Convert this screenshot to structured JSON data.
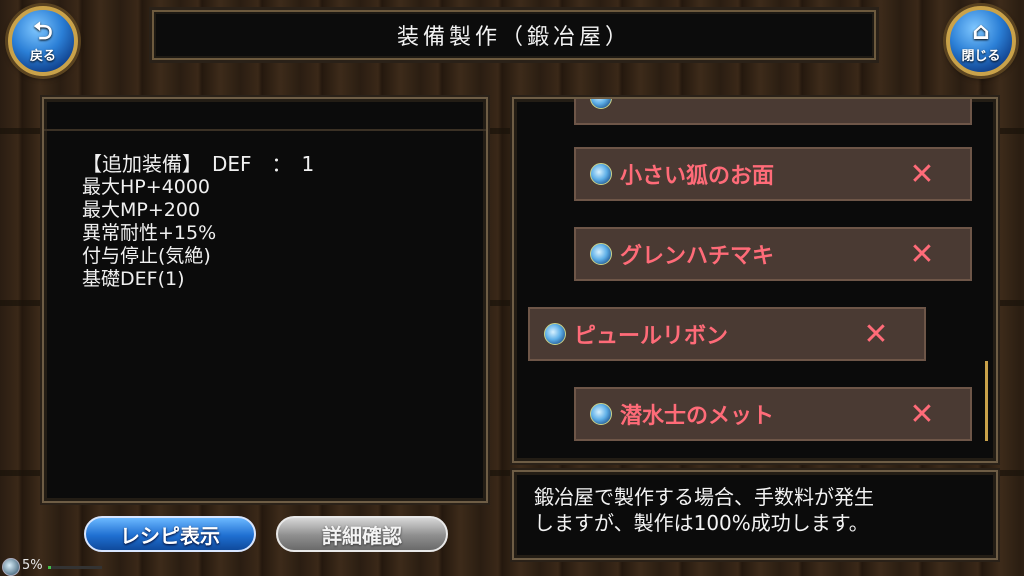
{
  "header": {
    "title": "装備製作（鍛冶屋）"
  },
  "nav": {
    "back_label": "戻る",
    "close_label": "閉じる"
  },
  "details": {
    "lines": [
      "【追加装備】　DEF　：　1",
      "最大HP+4000",
      "最大MP+200",
      "異常耐性+15%",
      "付与停止(気絶)",
      "基礎DEF(1)"
    ]
  },
  "materials": {
    "items": [
      {
        "name": "小さい狐のお面",
        "remove": "✕"
      },
      {
        "name": "グレンハチマキ",
        "remove": "✕"
      },
      {
        "name": "ピュールリボン",
        "remove": "✕"
      },
      {
        "name": "潜水士のメット",
        "remove": "✕"
      }
    ]
  },
  "message": {
    "line1": "鍛冶屋で製作する場合、手数料が発生",
    "line2": "しますが、製作は100%成功します。"
  },
  "buttons": {
    "recipe": "レシピ表示",
    "detail": "詳細確認"
  },
  "status": {
    "progress_text": "5%",
    "progress_value": 0.05
  },
  "colors": {
    "item_text": "#ff6b78",
    "accent_blue": "#2b7fd6",
    "frame_gold": "#c9a24a"
  }
}
